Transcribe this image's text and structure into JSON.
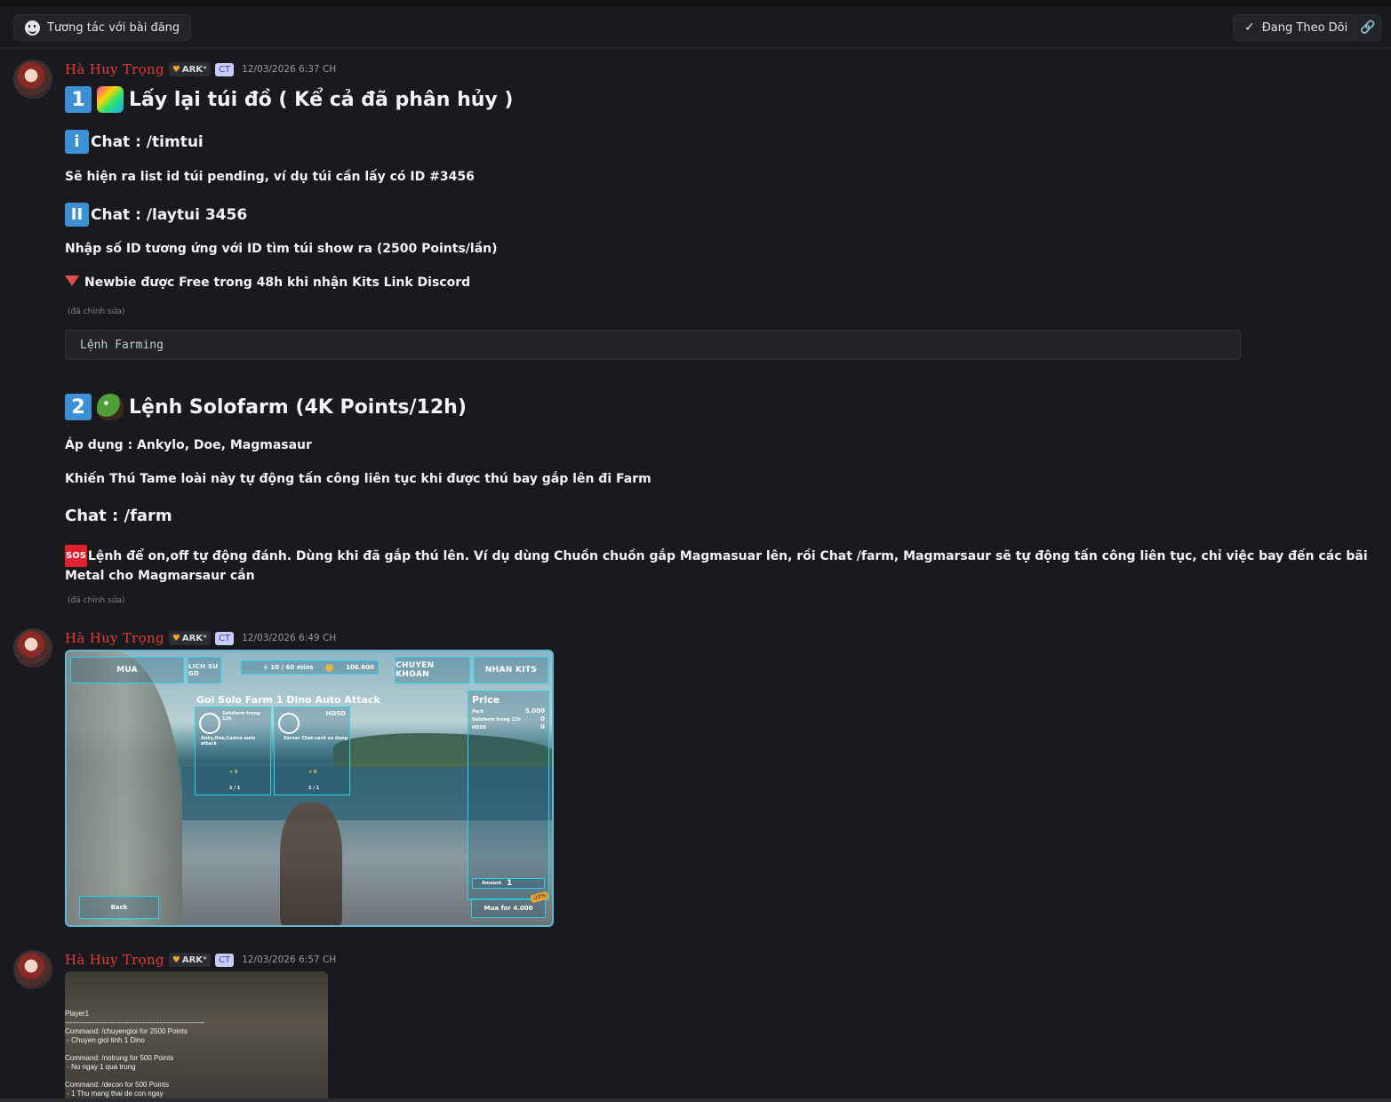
{
  "topbar": {
    "interact_label": "Tương tác với bài đăng",
    "follow_label": "Đang Theo Dõi"
  },
  "author": {
    "name": "Hà Huy Trọng",
    "tag": "ARKᵛ",
    "role": "CT"
  },
  "messages": [
    {
      "timestamp": "12/03/2026 6:37 CH",
      "h1_num": "1",
      "h1_text": "Lấy lại túi đồ ( Kể cả đã phân hủy )",
      "sub1_icon": "i",
      "sub1_text": "Chat : /timtui",
      "p1": "Sẽ hiện ra list id túi pending, ví dụ túi cần lấy có ID #3456",
      "sub2_icon": "II",
      "sub2_text": "Chat : /laytui 3456",
      "p2": "Nhập số ID tương ứng với ID tìm túi show ra (2500 Points/lần)",
      "p3": "Newbie được Free trong 48h khi nhận Kits Link Discord",
      "edited": "(đã chỉnh sửa)",
      "code": "Lệnh Farming",
      "h2_num": "2",
      "h2_text": "Lệnh Solofarm (4K Points/12h)",
      "p4": "Áp dụng : Ankylo, Doe, Magmasaur",
      "p5": "Khiến Thú Tame loài này tự động tấn công liên tục khi được thú bay gắp lên đi Farm",
      "chat_farm": "Chat : /farm",
      "sos": "SOS",
      "p6": "Lệnh để on,off tự động đánh. Dùng khi đã gắp thú lên. Ví dụ dùng Chuồn chuồn gắp Magmasuar lên, rồi Chat /farm, Magmarsaur sẽ tự động tấn công liên tục, chỉ việc bay đến các bãi Metal cho Magmarsaur cắn",
      "edited2": "(đã chỉnh sửa)"
    },
    {
      "timestamp": "12/03/2026 6:49 CH",
      "game_ui": {
        "tabs": [
          "MUA",
          "LICH SU GD",
          "CHUYEN KHOAN",
          "NHAN KITS"
        ],
        "currency_rate": "+ 10 / 60 mins",
        "currency": "106.600",
        "title": "Goi Solo Farm 1 Dino Auto Attack",
        "hdsd": "HDSD",
        "card1_name": "Solofarm trong 12h",
        "card1_desc": "Anky,Doe,Castro auto attack",
        "card1_price": "+ 0",
        "card1_qty": "1 / 1",
        "card2_desc": "Server Chat cach su dung",
        "card2_price": "+ 0",
        "card2_qty": "1 / 1",
        "price_title": "Price",
        "price_rows": [
          {
            "label": "Pack",
            "value": "5.000"
          },
          {
            "label": "Solofarm trong 12h",
            "value": "0"
          },
          {
            "label": "HDSD",
            "value": "0"
          }
        ],
        "amount_label": "Amount",
        "amount": "1",
        "buy_label": "Mua for 4.000",
        "discount": "-20%",
        "back_label": "Back"
      }
    },
    {
      "timestamp": "12/03/2026 6:57 CH",
      "terminal": "Player1\n-----------------------------------------------------------\nCommand: /chuyengioi for 2500 Points\n - Chuyen gioi tinh 1 Dino\n\nCommand: /notrung for 500 Points\n - No ngay 1 qua trung\n\nCommand: /decon for 500 Points\n - 1 Thu mang thai de con ngay"
    }
  ]
}
